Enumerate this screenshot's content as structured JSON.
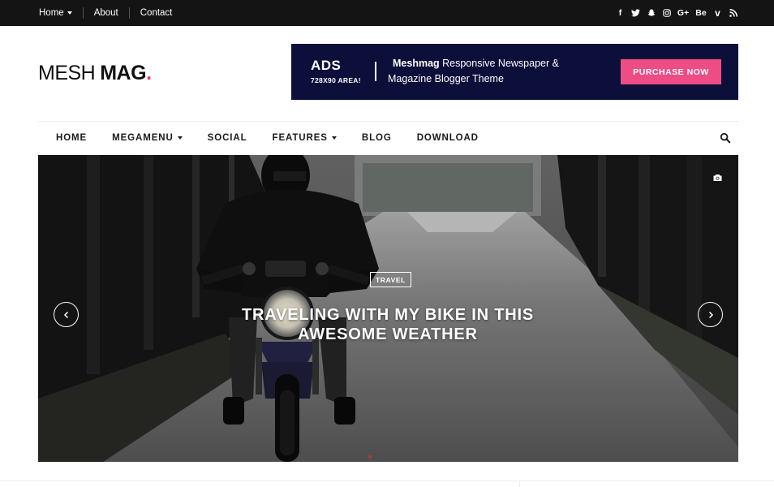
{
  "topbar": {
    "links": [
      {
        "label": "Home",
        "has_dropdown": true
      },
      {
        "label": "About",
        "has_dropdown": false
      },
      {
        "label": "Contact",
        "has_dropdown": false
      }
    ],
    "social": {
      "facebook": "f",
      "behance": "Be",
      "google_plus": "G+",
      "vimeo": "v",
      "icons": [
        "facebook-icon",
        "twitter-icon",
        "snapchat-icon",
        "instagram-icon",
        "google-plus-icon",
        "behance-icon",
        "vimeo-icon",
        "rss-icon"
      ]
    }
  },
  "header": {
    "logo": {
      "part1": "MESH",
      "part2": "MAG",
      "dot": "."
    },
    "ad": {
      "title": "ADS",
      "subtitle": "728X90 AREA!",
      "line1_bold": "Meshmag",
      "line1_rest": " Responsive Newspaper &",
      "line2": "Magazine  Blogger Theme",
      "button": "PURCHASE NOW"
    }
  },
  "nav": {
    "items": [
      {
        "label": "HOME",
        "has_dropdown": false
      },
      {
        "label": "MEGAMENU",
        "has_dropdown": true
      },
      {
        "label": "SOCIAL",
        "has_dropdown": false
      },
      {
        "label": "FEATURES",
        "has_dropdown": true
      },
      {
        "label": "BLOG",
        "has_dropdown": false
      },
      {
        "label": "DOWNLOAD",
        "has_dropdown": false
      }
    ]
  },
  "slider": {
    "category": "TRAVEL",
    "title_line1": "TRAVELING WITH MY BIKE IN THIS",
    "title_line2": "AWESOME WEATHER"
  },
  "colors": {
    "topbar_bg": "#141414",
    "accent_pink": "#f0337a",
    "ad_bg": "#0c0f3a",
    "ad_button": "#ee4c84"
  }
}
